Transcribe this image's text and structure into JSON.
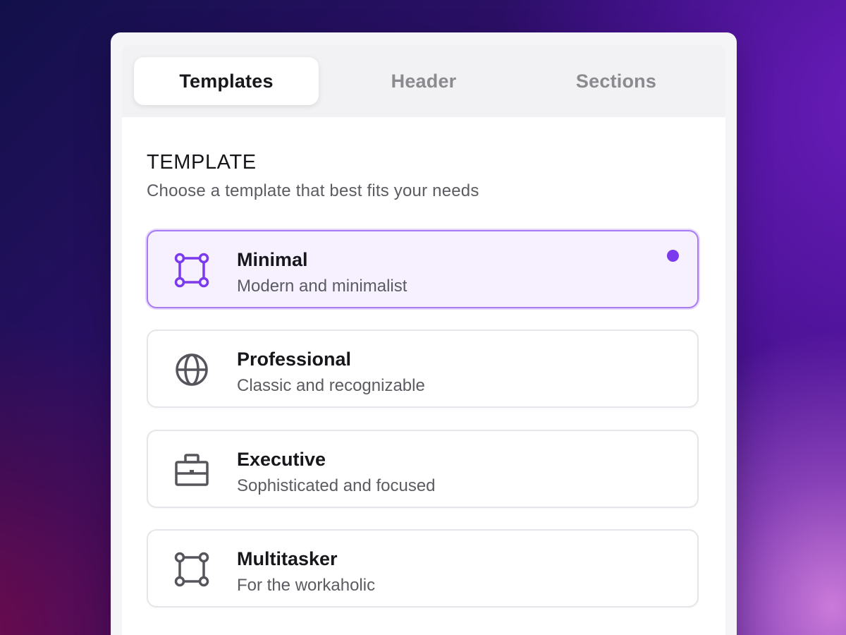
{
  "colors": {
    "accent": "#7c3aed",
    "selected_background": "#f6f0ff",
    "selected_border": "#a77cf2",
    "text_primary": "#16161b",
    "text_secondary": "#5b5b62",
    "tab_inactive": "#8a8a8f"
  },
  "tabs": [
    {
      "label": "Templates",
      "active": true
    },
    {
      "label": "Header",
      "active": false
    },
    {
      "label": "Sections",
      "active": false
    }
  ],
  "section": {
    "title": "TEMPLATE",
    "subtitle": "Choose a template that best fits your needs"
  },
  "templates": [
    {
      "name": "Minimal",
      "description": "Modern and minimalist",
      "icon": "frame-square-icon",
      "selected": true
    },
    {
      "name": "Professional",
      "description": "Classic and recognizable",
      "icon": "globe-icon",
      "selected": false
    },
    {
      "name": "Executive",
      "description": "Sophisticated and focused",
      "icon": "briefcase-icon",
      "selected": false
    },
    {
      "name": "Multitasker",
      "description": "For the workaholic",
      "icon": "frame-square-icon",
      "selected": false
    }
  ]
}
